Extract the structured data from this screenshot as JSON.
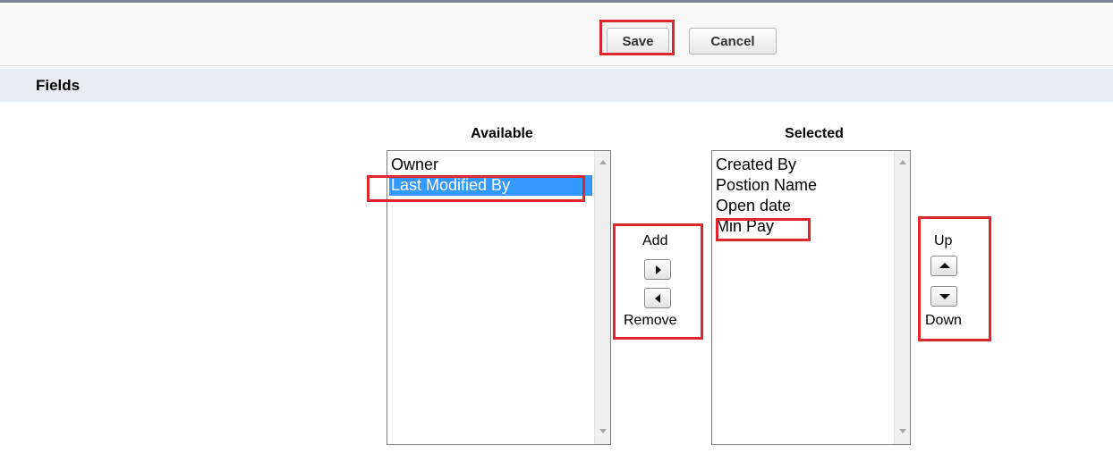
{
  "toolbar": {
    "save_label": "Save",
    "cancel_label": "Cancel"
  },
  "section": {
    "title": "Fields"
  },
  "available": {
    "title": "Available",
    "items": [
      "Owner",
      "Last Modified By"
    ],
    "selected_item": "Last Modified By"
  },
  "selected": {
    "title": "Selected",
    "items": [
      "Created By",
      "Postion Name",
      "Open date",
      "Min Pay"
    ]
  },
  "actions": {
    "add_label": "Add",
    "remove_label": "Remove",
    "up_label": "Up",
    "down_label": "Down"
  },
  "icons": {
    "add": "triangle-right-icon",
    "remove": "triangle-left-icon",
    "up": "triangle-up-icon",
    "down": "triangle-down-icon"
  },
  "colors": {
    "highlight_box": "#e0252b",
    "selection": "#3399ff",
    "section_header": "#e6ecf2"
  }
}
